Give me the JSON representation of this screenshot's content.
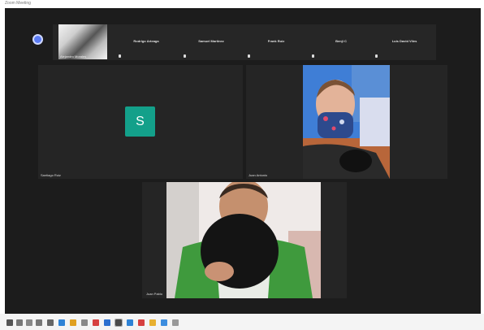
{
  "window": {
    "title": "Zoom Meeting"
  },
  "settings_icon": "gear-icon",
  "self_view": {
    "name": "Alejandro Morales"
  },
  "participants": [
    {
      "name": "Rodrigo Arteaga"
    },
    {
      "name": "Samuel Martinez"
    },
    {
      "name": "Frank Ruiz"
    },
    {
      "name": "Benji C"
    },
    {
      "name": "Luis David Viles"
    }
  ],
  "main_tiles": {
    "avatar_tile": {
      "initial": "S",
      "label": "Santiago Ruiz",
      "avatar_color": "#13a08a"
    },
    "video_tile_1": {
      "label": "Juan Antonio"
    },
    "video_tile_2": {
      "label": "Juan Pablo"
    }
  },
  "taskbar_icons": [
    "windows-start-icon",
    "search-icon",
    "task-view-icon",
    "edge-icon",
    "file-explorer-icon",
    "store-icon",
    "mail-icon",
    "zoom-icon",
    "word-icon",
    "excel-icon",
    "powerpoint-icon",
    "photos-icon",
    "chrome-icon"
  ],
  "colors": {
    "background": "#1c1c1c",
    "tile": "#252525",
    "accent": "#5b7cf4"
  }
}
